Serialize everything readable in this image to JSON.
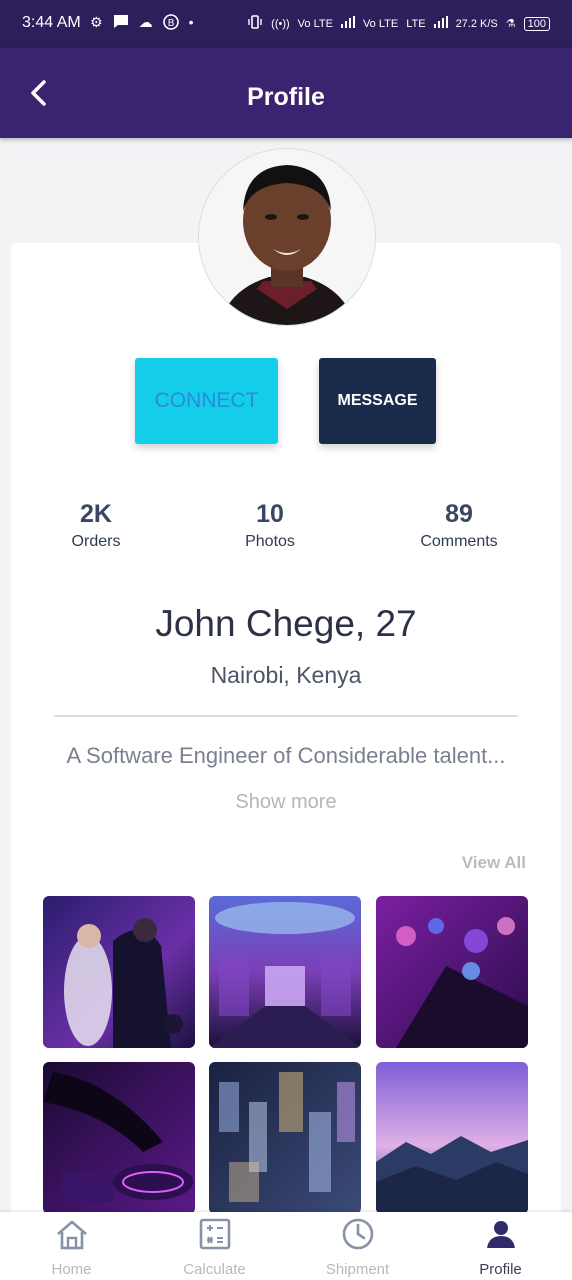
{
  "status_bar": {
    "time": "3:44 AM",
    "icons": [
      "settings-icon",
      "chat-bubble-icon",
      "cloud-icon",
      "b-circle-icon",
      "dot-icon"
    ],
    "network": [
      "Vo LTE",
      "Vo LTE",
      "LTE",
      "27.2 K/S"
    ],
    "battery": "100"
  },
  "app_bar": {
    "title": "Profile",
    "back_icon": "chevron-left-icon"
  },
  "actions": {
    "connect_label": "CONNECT",
    "message_label": "MESSAGE"
  },
  "stats": [
    {
      "value": "2K",
      "label": "Orders"
    },
    {
      "value": "10",
      "label": "Photos"
    },
    {
      "value": "89",
      "label": "Comments"
    }
  ],
  "profile": {
    "name": "John Chege, 27",
    "location": "Nairobi, Kenya",
    "bio": "A Software Engineer of Considerable talent...",
    "show_more": "Show more"
  },
  "gallery": {
    "view_all": "View All",
    "thumbnails": [
      "wedding-dance-photo",
      "purple-hall-photo",
      "purple-crystals-photo",
      "dj-turntable-photo",
      "city-night-aerial-photo",
      "mountain-sunset-photo"
    ]
  },
  "bottom_nav": [
    {
      "label": "Home",
      "icon": "home-icon"
    },
    {
      "label": "Calculate",
      "icon": "calculator-icon"
    },
    {
      "label": "Shipment",
      "icon": "clock-icon"
    },
    {
      "label": "Profile",
      "icon": "person-icon"
    }
  ],
  "colors": {
    "status_bar": "#2c1f5c",
    "app_bar": "#3a2470",
    "connect": "#14cde9",
    "message": "#1a2a4b"
  }
}
